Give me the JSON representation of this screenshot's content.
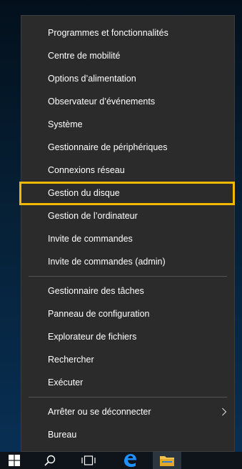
{
  "menu": {
    "group1": [
      {
        "label": "Programmes et fonctionnalités"
      },
      {
        "label": "Centre de mobilité"
      },
      {
        "label": "Options d’alimentation"
      },
      {
        "label": "Observateur d’événements"
      },
      {
        "label": "Système"
      },
      {
        "label": "Gestionnaire de périphériques"
      },
      {
        "label": "Connexions réseau"
      },
      {
        "label": "Gestion du disque"
      },
      {
        "label": "Gestion de l’ordinateur"
      },
      {
        "label": "Invite de commandes"
      },
      {
        "label": "Invite de commandes (admin)"
      }
    ],
    "group2": [
      {
        "label": "Gestionnaire des tâches"
      },
      {
        "label": "Panneau de configuration"
      },
      {
        "label": "Explorateur de fichiers"
      },
      {
        "label": "Rechercher"
      },
      {
        "label": "Exécuter"
      }
    ],
    "group3": [
      {
        "label": "Arrêter ou se déconnecter",
        "submenu_icon": "chevron-right-icon"
      },
      {
        "label": "Bureau"
      }
    ]
  },
  "highlighted_item": "Gestion du disque",
  "colors": {
    "menu_background": "#2b2b2b",
    "highlight_border": "#f3b800",
    "separator": "#555555",
    "taskbar": "#0e1419",
    "edge_blue": "#1e90ff",
    "explorer_folder": "#f2c14e"
  },
  "taskbar": {
    "icons": [
      "windows-start-icon",
      "search-icon",
      "task-view-icon",
      "edge-browser-icon",
      "file-explorer-icon"
    ]
  }
}
